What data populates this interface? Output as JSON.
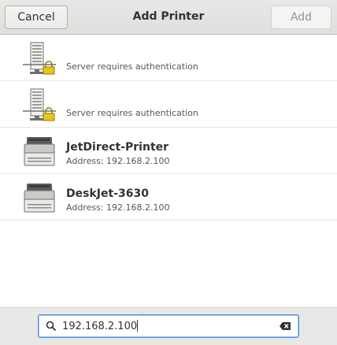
{
  "header": {
    "title": "Add Printer",
    "cancel_label": "Cancel",
    "add_label": "Add"
  },
  "printers": [
    {
      "icon": "network-server-lock-icon",
      "name": "",
      "detail": "Server requires authentication"
    },
    {
      "icon": "network-server-lock-icon",
      "name": "",
      "detail": "Server requires authentication"
    },
    {
      "icon": "printer-icon",
      "name": "JetDirect-Printer",
      "detail": "Address: 192.168.2.100"
    },
    {
      "icon": "printer-icon",
      "name": "DeskJet-3630",
      "detail": "Address: 192.168.2.100"
    }
  ],
  "search": {
    "value": "192.168.2.100",
    "search_icon": "search-icon",
    "clear_icon": "clear-text-icon"
  },
  "colors": {
    "focus_border": "#4a90d9",
    "header_bg": "#dfdfdd",
    "lock": "#e8c51a"
  }
}
